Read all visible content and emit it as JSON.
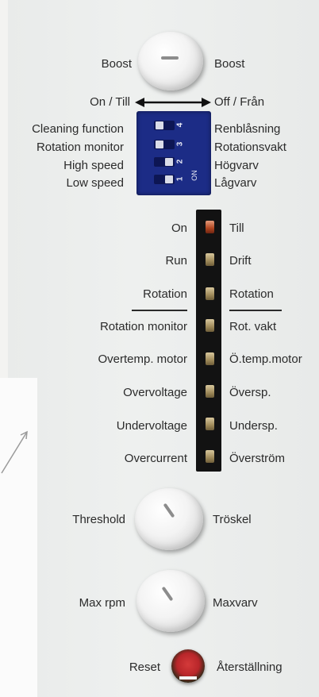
{
  "top": {
    "boost_left": "Boost",
    "boost_right": "Boost",
    "direction_left": "On / Till",
    "direction_right": "Off / Från"
  },
  "dip_switches": {
    "numbers": [
      "4",
      "3",
      "2",
      "1"
    ],
    "on_label": "ON",
    "items": [
      {
        "en": "Cleaning function",
        "sv": "Renblåsning"
      },
      {
        "en": "Rotation monitor",
        "sv": "Rotationsvakt"
      },
      {
        "en": "High speed",
        "sv": "Högvarv"
      },
      {
        "en": "Low speed",
        "sv": "Lågvarv"
      }
    ]
  },
  "leds": [
    {
      "en": "On",
      "sv": "Till",
      "state": "on"
    },
    {
      "en": "Run",
      "sv": "Drift",
      "state": "off"
    },
    {
      "en": "Rotation",
      "sv": "Rotation",
      "state": "off"
    },
    {
      "en": "Rotation monitor",
      "sv": "Rot. vakt",
      "state": "off"
    },
    {
      "en": "Overtemp. motor",
      "sv": "Ö.temp.motor",
      "state": "off"
    },
    {
      "en": "Overvoltage",
      "sv": "Översp.",
      "state": "off"
    },
    {
      "en": "Undervoltage",
      "sv": "Undersp.",
      "state": "off"
    },
    {
      "en": "Overcurrent",
      "sv": "Överström",
      "state": "off"
    }
  ],
  "threshold": {
    "en": "Threshold",
    "sv": "Tröskel"
  },
  "max_rpm": {
    "en": "Max rpm",
    "sv": "Maxvarv"
  },
  "reset": {
    "en": "Reset",
    "sv": "Återställning"
  },
  "colors": {
    "panel": "#eceeed",
    "dip": "#1c2c86",
    "led_on": "#b0451f",
    "reset_button": "#c42f32"
  }
}
